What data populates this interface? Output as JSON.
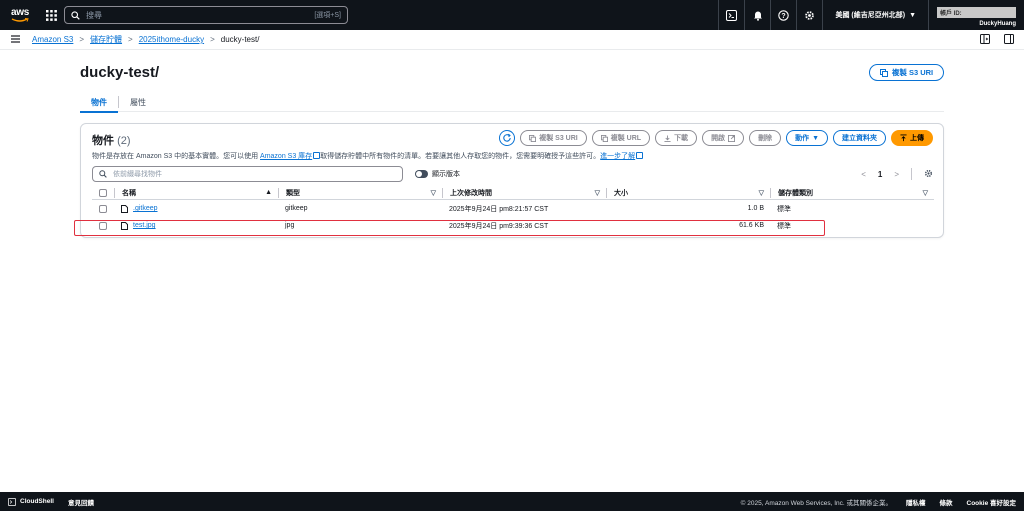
{
  "topnav": {
    "logo_text": "aws",
    "search_placeholder": "搜尋",
    "search_shortcut": "[選項+S]",
    "region": "美國 (維吉尼亞州北部)",
    "account_label": "帳戶 ID:",
    "user": "DuckyHuang"
  },
  "breadcrumb": {
    "items": [
      "Amazon S3",
      "儲存貯體",
      "2025ithome-ducky"
    ],
    "current": "ducky-test/"
  },
  "page": {
    "title": "ducky-test/",
    "copy_uri_label": "複製 S3 URI"
  },
  "tabs": [
    {
      "label": "物件",
      "active": true
    },
    {
      "label": "屬性",
      "active": false
    }
  ],
  "objects": {
    "title": "物件",
    "count": "(2)",
    "desc_pre": "物件是存放在 Amazon S3 中的基本實體。您可以使用 ",
    "desc_link1": "Amazon S3 庫存",
    "desc_mid": "取得儲存貯體中所有物件的清單。若要讓其他人存取您的物件，您需要明確授予這些許可。",
    "desc_link2": "進一步了解",
    "buttons": {
      "copy_s3_uri": "複製 S3 URI",
      "copy_url": "複製 URL",
      "download": "下載",
      "open": "開啟",
      "delete": "刪除",
      "actions": "動作",
      "create_folder": "建立資料夾",
      "upload": "上傳"
    },
    "filter_placeholder": "依前綴尋找物件",
    "show_versions": "顯示版本",
    "page_number": "1",
    "columns": [
      "名稱",
      "類型",
      "上次修改時間",
      "大小",
      "儲存體類別"
    ],
    "rows": [
      {
        "name": ".gitkeep",
        "type": "gitkeep",
        "modified": "2025年9月24日 pm8:21:57 CST",
        "size": "1.0 B",
        "storage_class": "標準"
      },
      {
        "name": "test.jpg",
        "type": "jpg",
        "modified": "2025年9月24日 pm9:39:36 CST",
        "size": "61.6 KB",
        "storage_class": "標準"
      }
    ]
  },
  "footer": {
    "cloudshell": "CloudShell",
    "feedback": "意見回饋",
    "copyright": "© 2025, Amazon Web Services, Inc. 或其關係企業。",
    "privacy": "隱私權",
    "terms": "條款",
    "cookie": "Cookie 喜好設定"
  },
  "colors": {
    "nav_bg": "#0f141a",
    "link": "#0972d3",
    "upload": "#ff9900",
    "highlight": "#e0303f"
  }
}
